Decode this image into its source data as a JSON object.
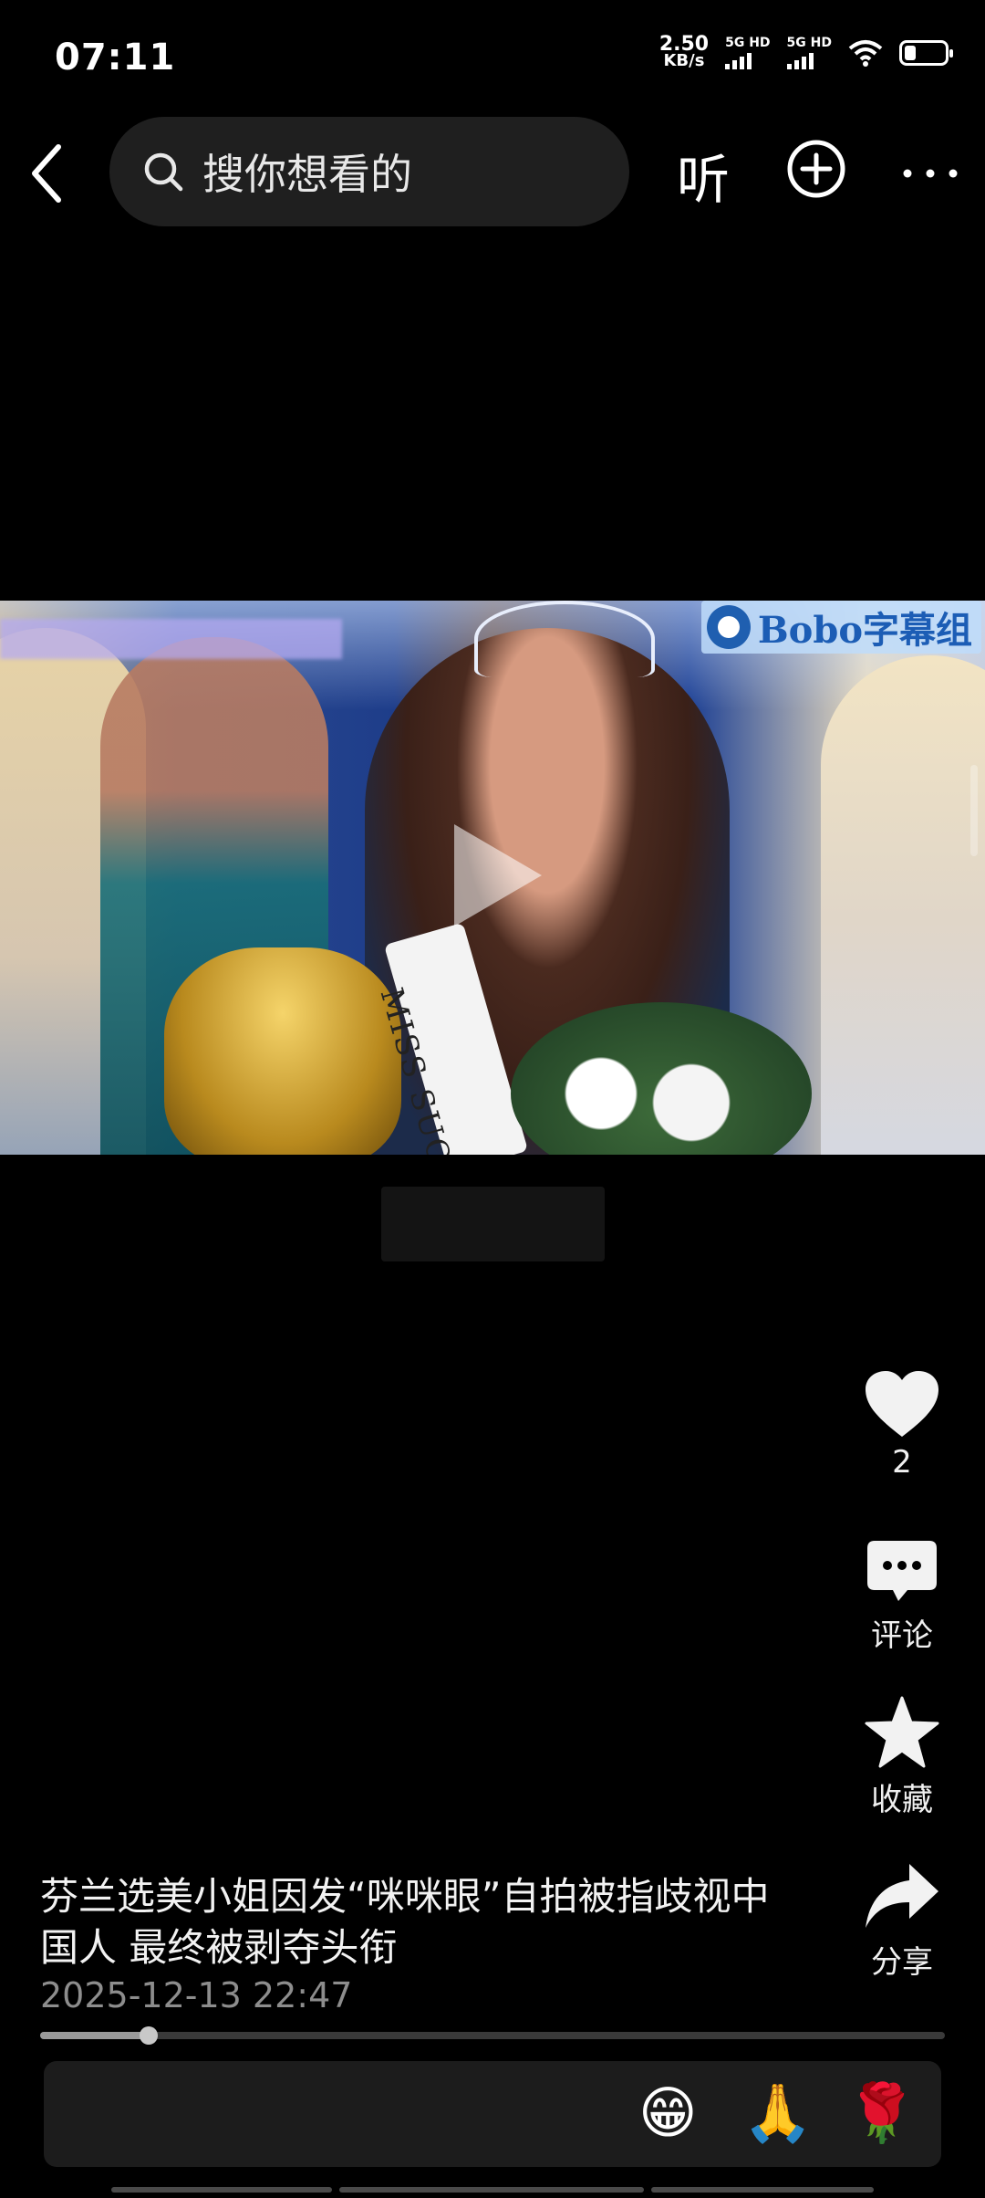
{
  "status_bar": {
    "time": "07:11",
    "net_speed_value": "2.50",
    "net_speed_unit": "KB/s",
    "signal_1_label": "5G HD",
    "signal_2_label": "5G HD",
    "icons": [
      "wifi-icon",
      "battery-icon"
    ]
  },
  "nav": {
    "search_placeholder": "搜你想看的",
    "listen_label": "听",
    "icons": [
      "back-icon",
      "search-icon",
      "add-circle-icon",
      "more-icon"
    ]
  },
  "video": {
    "watermark_text": "Bobo字幕组",
    "sash_text": "MISS SUO",
    "icons": [
      "play-icon"
    ]
  },
  "actions": {
    "like_count": "2",
    "comment_label": "评论",
    "favorite_label": "收藏",
    "share_label": "分享",
    "icons": [
      "heart-icon",
      "comment-icon",
      "star-icon",
      "share-icon"
    ]
  },
  "post": {
    "caption": "芬兰选美小姐因发“咪咪眼”自拍被指歧视中国人 最终被剥夺头衔",
    "timestamp": "2025-12-13 22:47",
    "progress_fraction": 0.12
  },
  "comment_bar": {
    "placeholder": "",
    "quick_emojis": [
      "😁",
      "🙏",
      "🌹"
    ]
  },
  "colors": {
    "background": "#000000",
    "text": "#ffffff",
    "muted": "#8d8d8d",
    "search_bg": "#1f1f1f"
  }
}
